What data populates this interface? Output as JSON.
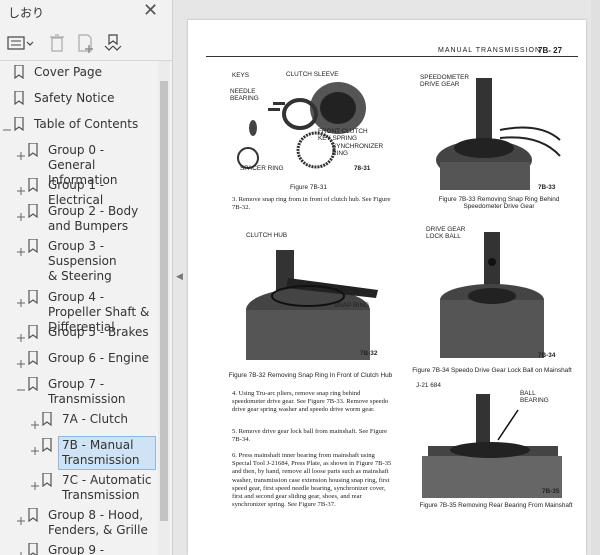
{
  "panel": {
    "title": "しおり",
    "close_icon": "close-icon"
  },
  "toolbar": {
    "icons": [
      "list-options-icon",
      "delete-icon",
      "new-bookmark-icon",
      "expand-bookmark-icon"
    ]
  },
  "bookmarks": [
    {
      "label": "Cover Page"
    },
    {
      "label": "Safety Notice"
    },
    {
      "label": "Table of Contents"
    },
    {
      "label": "Group 0 - General Information"
    },
    {
      "label": "Group 1 - Electrical"
    },
    {
      "label": "Group 2 - Body and Bumpers"
    },
    {
      "label": "Group 3 - Suspension & Steering"
    },
    {
      "label": "Group 4 - Propeller Shaft & Differential"
    },
    {
      "label": "Group 5 - Brakes"
    },
    {
      "label": "Group 6 - Engine"
    },
    {
      "label": "Group 7 - Transmission"
    },
    {
      "label": "7A - Clutch"
    },
    {
      "label": "7B - Manual Transmission",
      "selected": true
    },
    {
      "label": "7C - Automatic Transmission"
    },
    {
      "label": "Group 8 - Hood, Fenders, & Grille"
    },
    {
      "label": "Group 9 -"
    }
  ],
  "doc": {
    "header_title": "MANUAL TRANSMISSION",
    "header_page": "7B- 27",
    "fig31": {
      "labels": [
        "KEYS",
        "CLUTCH SLEEVE",
        "NEEDLE BEARING",
        "FRONT CLUTCH KEY SPRING",
        "SYNCHRONIZER RING",
        "SPACER RING",
        "78-31"
      ],
      "caption": "Figure 7B-31"
    },
    "fig33": {
      "labels": [
        "SPEEDOMETER DRIVE GEAR",
        "7B-33"
      ],
      "caption": "Figure 7B-33 Removing Snap Ring Behind Speedometer Drive Gear"
    },
    "fig32": {
      "labels": [
        "CLUTCH HUB",
        "SNAP RING",
        "7B-32"
      ],
      "caption": "Figure 7B-32 Removing Snap Ring In Front of Clutch Hub"
    },
    "fig34": {
      "labels": [
        "DRIVE GEAR LOCK BALL",
        "7B-34"
      ],
      "caption": "Figure 7B-34 Speedo Drive Gear Lock Ball on Mainshaft"
    },
    "fig35": {
      "labels": [
        "J-21 684",
        "BALL BEARING",
        "7B-35"
      ],
      "caption": "Figure 7B-35 Removing Rear Bearing From Mainshaft"
    },
    "step3": "3. Remove snap ring from in front of clutch hub. See Figure 7B-32.",
    "step4": "4. Using Tru-arc pliers, remove snap ring behind speedometer drive gear. See Figure 7B-33. Remove speedo drive gear spring washer and speedo drive worm gear.",
    "step5": "5. Remove drive gear lock ball from mainshaft. See Figure 7B-34.",
    "step6": "6. Press mainshaft inner bearing from mainshaft using Special Tool J-21684, Press Plate, as shown in Figure 7B-35 and then, by hand, remove all loose parts such as mainshaft washer, transmission case extension housing snap ring, first speed gear, first speed needle bearing, synchronizer cover, first and second gear sliding gear, shoes, and rear synchronizer spring. See Figure 7B-37."
  }
}
